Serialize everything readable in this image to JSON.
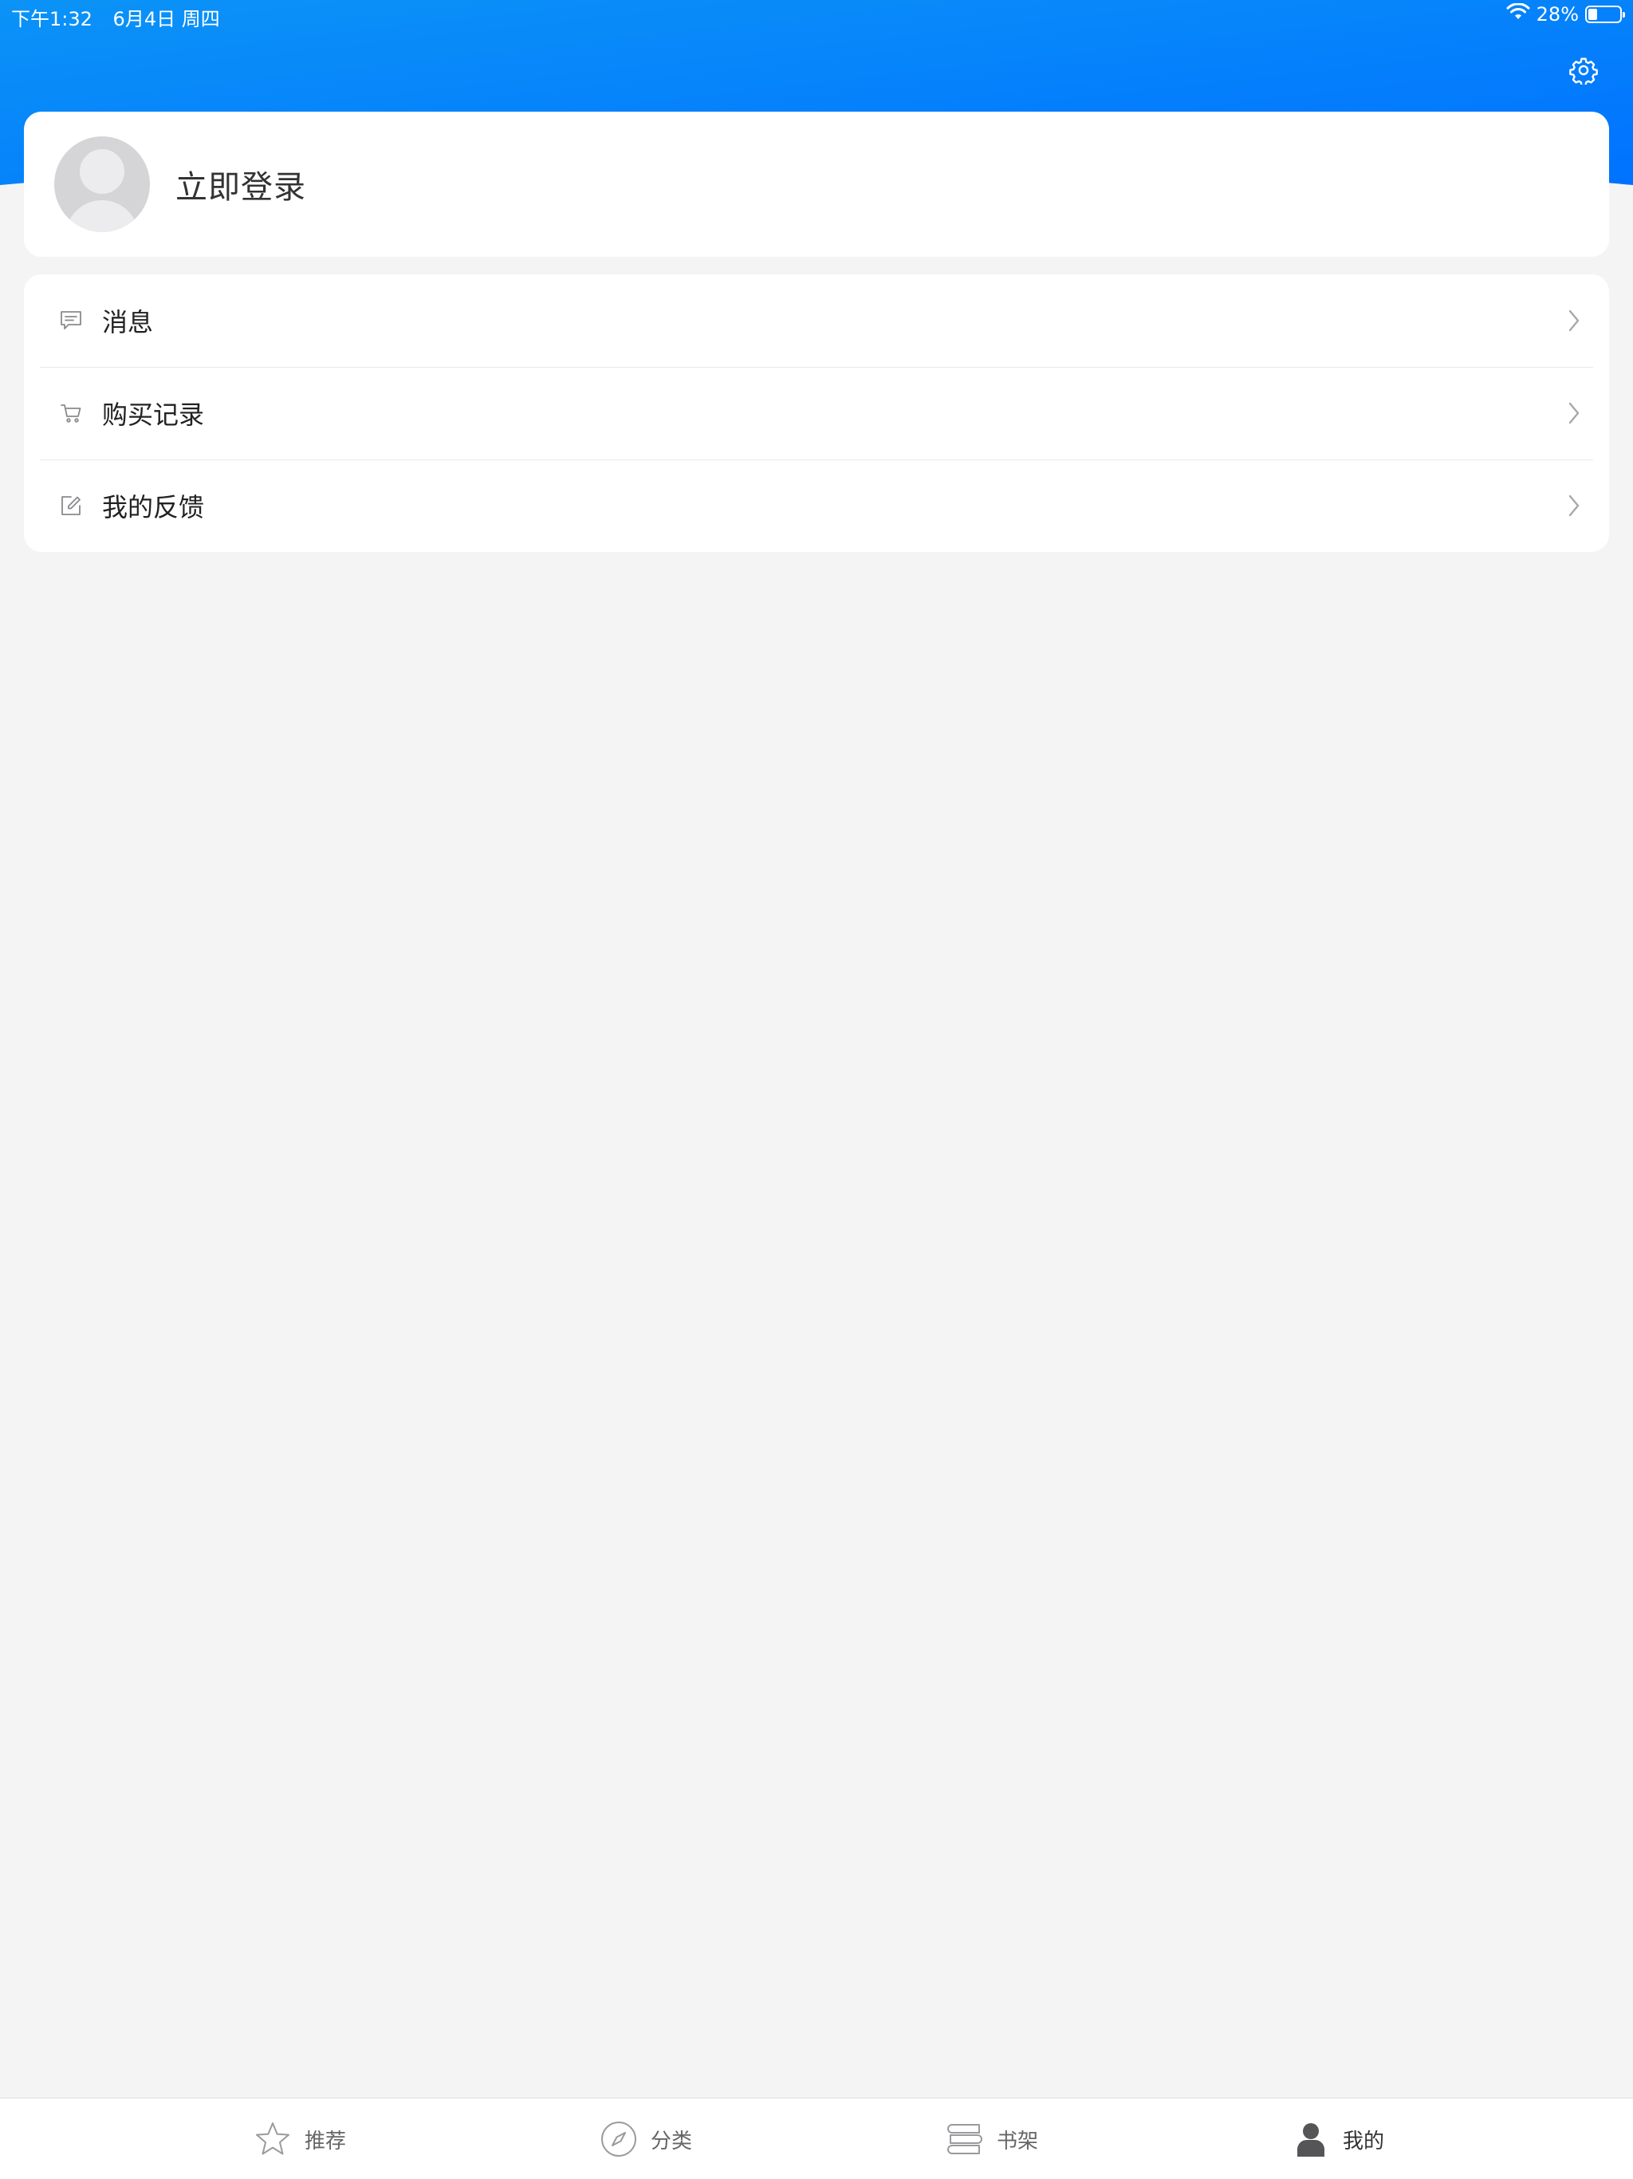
{
  "status_bar": {
    "time": "下午1:32",
    "date": "6月4日 周四",
    "battery_percent_text": "28%",
    "battery_level": 0.28
  },
  "colors": {
    "header_gradient_start": "#0b8ff5",
    "header_gradient_end": "#0077ff",
    "background": "#f4f4f5",
    "card": "#ffffff"
  },
  "header": {
    "settings_icon": "gear-icon"
  },
  "login": {
    "label": "立即登录",
    "avatar_icon": "default-avatar-icon"
  },
  "menu": {
    "items": [
      {
        "label": "消息",
        "icon": "message-icon"
      },
      {
        "label": "购买记录",
        "icon": "cart-icon"
      },
      {
        "label": "我的反馈",
        "icon": "edit-icon"
      }
    ]
  },
  "tab_bar": {
    "tabs": [
      {
        "label": "推荐",
        "icon": "star-icon",
        "active": false
      },
      {
        "label": "分类",
        "icon": "compass-icon",
        "active": false
      },
      {
        "label": "书架",
        "icon": "bookshelf-icon",
        "active": false
      },
      {
        "label": "我的",
        "icon": "person-icon",
        "active": true
      }
    ]
  }
}
